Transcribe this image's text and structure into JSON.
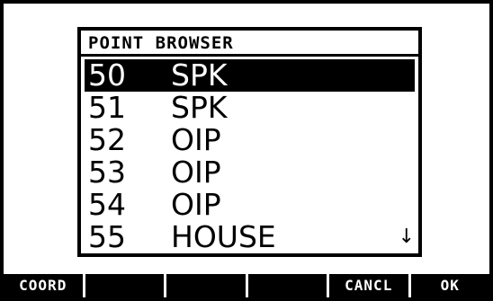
{
  "dialog": {
    "title": "POINT BROWSER"
  },
  "points": [
    {
      "number": "50",
      "description": "SPK",
      "selected": true
    },
    {
      "number": "51",
      "description": "SPK",
      "selected": false
    },
    {
      "number": "52",
      "description": "OIP",
      "selected": false
    },
    {
      "number": "53",
      "description": "OIP",
      "selected": false
    },
    {
      "number": "54",
      "description": "OIP",
      "selected": false
    },
    {
      "number": "55",
      "description": "HOUSE",
      "selected": false
    }
  ],
  "scroll": {
    "up_icon": "arrow-up-icon",
    "down_icon": "arrow-down-icon",
    "up_glyph": "↑",
    "down_glyph": "↓"
  },
  "softkeys": [
    "COORD",
    "",
    "",
    "",
    "CANCL",
    "OK"
  ],
  "colors": {
    "background": "#ffffff",
    "foreground": "#000000"
  }
}
